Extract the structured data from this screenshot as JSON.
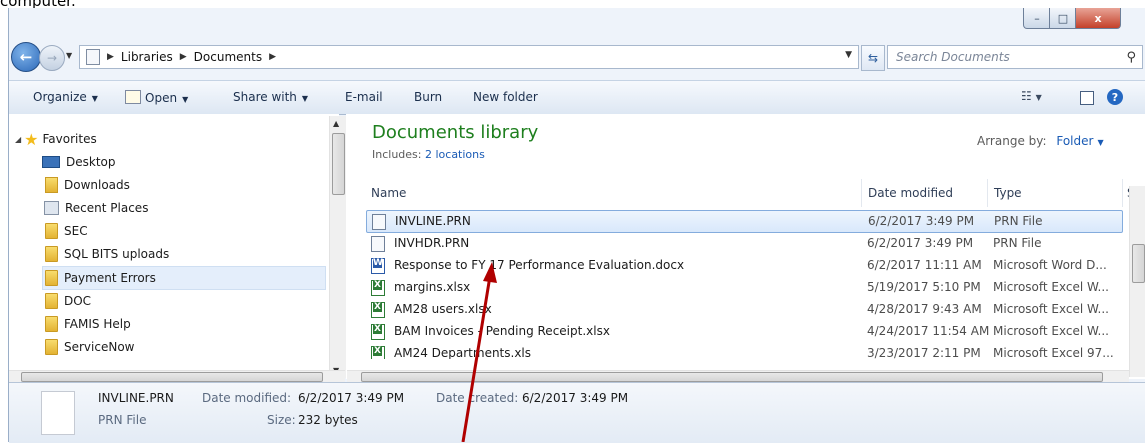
{
  "window": {
    "controls": {
      "minimize": "–",
      "maximize": "□",
      "close": "x"
    }
  },
  "addressbar": {
    "crumbs": [
      "Libraries",
      "Documents"
    ],
    "search_placeholder": "Search Documents"
  },
  "toolbar": {
    "organize": "Organize",
    "open": "Open",
    "share_with": "Share with",
    "email": "E-mail",
    "burn": "Burn",
    "new_folder": "New folder"
  },
  "navpane": {
    "favorites": "Favorites",
    "items": [
      {
        "label": "Desktop",
        "icon": "desktop-icon"
      },
      {
        "label": "Downloads",
        "icon": "downloads-folder-icon"
      },
      {
        "label": "Recent Places",
        "icon": "recent-places-icon"
      },
      {
        "label": "SEC",
        "icon": "folder-icon"
      },
      {
        "label": "SQL BITS uploads",
        "icon": "folder-icon"
      },
      {
        "label": "Payment Errors",
        "icon": "folder-icon",
        "selected": true
      },
      {
        "label": "DOC",
        "icon": "folder-icon"
      },
      {
        "label": "FAMIS Help",
        "icon": "folder-icon"
      },
      {
        "label": "ServiceNow",
        "icon": "folder-icon"
      }
    ]
  },
  "library": {
    "title": "Documents library",
    "includes_label": "Includes:",
    "includes_link": "2 locations",
    "arrange_label": "Arrange by:",
    "arrange_value": "Folder"
  },
  "columns": {
    "name": "Name",
    "date": "Date modified",
    "type": "Type",
    "size": "S"
  },
  "files": [
    {
      "name": "INVLINE.PRN",
      "date": "6/2/2017 3:49 PM",
      "type": "PRN File",
      "icon": "prn-file-icon",
      "selected": true
    },
    {
      "name": "INVHDR.PRN",
      "date": "6/2/2017 3:49 PM",
      "type": "PRN File",
      "icon": "prn-file-icon"
    },
    {
      "name": "Response to FY 17 Performance Evaluation.docx",
      "date": "6/2/2017 11:11 AM",
      "type": "Microsoft Word D...",
      "icon": "word-file-icon"
    },
    {
      "name": "margins.xlsx",
      "date": "5/19/2017 5:10 PM",
      "type": "Microsoft Excel W...",
      "icon": "excel-file-icon"
    },
    {
      "name": "AM28 users.xlsx",
      "date": "4/28/2017 9:43 AM",
      "type": "Microsoft Excel W...",
      "icon": "excel-file-icon"
    },
    {
      "name": "BAM Invoices - Pending Receipt.xlsx",
      "date": "4/24/2017 11:54 AM",
      "type": "Microsoft Excel W...",
      "icon": "excel-file-icon"
    },
    {
      "name": "AM24 Departments.xls",
      "date": "3/23/2017 2:11 PM",
      "type": "Microsoft Excel 97...",
      "icon": "excel-file-icon"
    }
  ],
  "details": {
    "name": "INVLINE.PRN",
    "type": "PRN File",
    "date_modified_label": "Date modified:",
    "date_modified": "6/2/2017 3:49 PM",
    "date_created_label": "Date created:",
    "date_created": "6/2/2017 3:49 PM",
    "size_label": "Size:",
    "size": "232 bytes"
  },
  "caption": "computer.",
  "colors": {
    "library_title": "#1e7f1e",
    "link": "#1a5bb5",
    "arrow": "#b00000"
  }
}
